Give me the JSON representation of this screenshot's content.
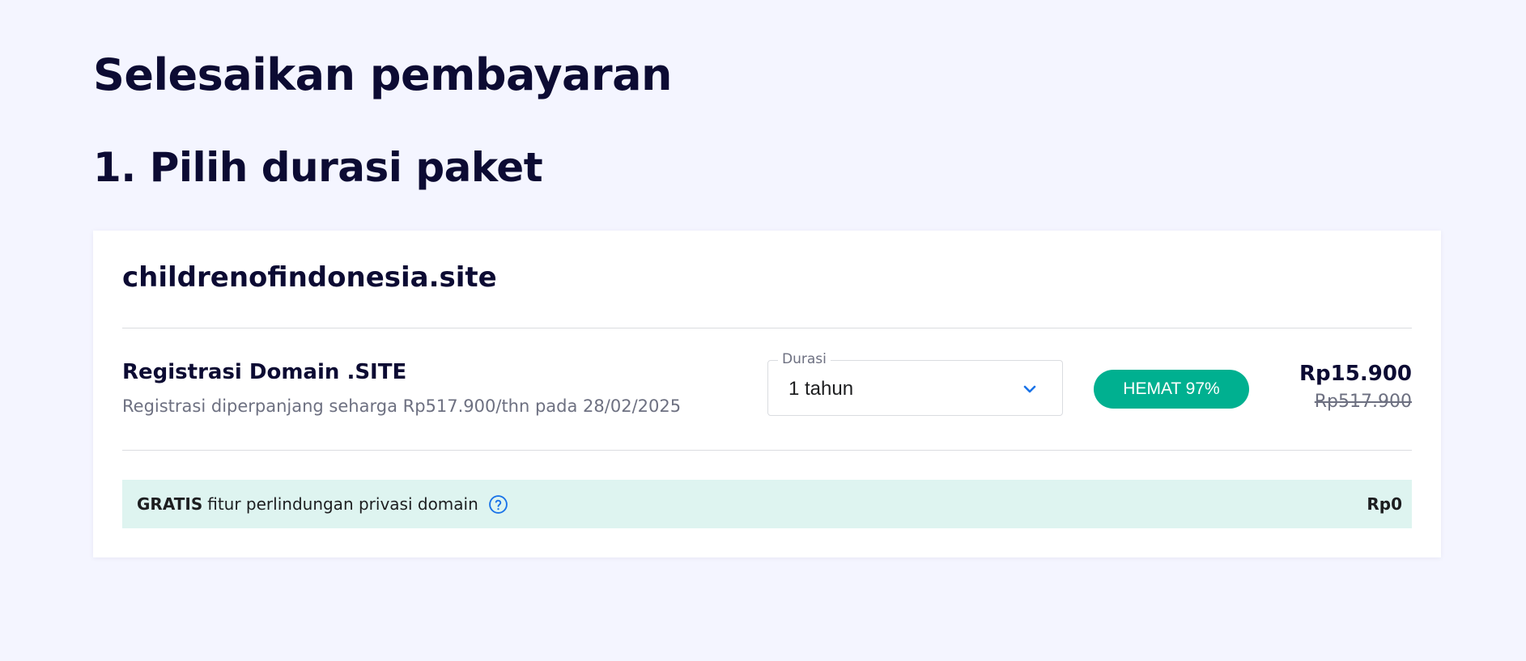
{
  "page": {
    "title": "Selesaikan pembayaran",
    "section_title": "1. Pilih durasi paket"
  },
  "card": {
    "domain_name": "childrenofindonesia.site",
    "product": {
      "name": "Registrasi Domain .SITE",
      "renewal_note": "Registrasi diperpanjang seharga Rp517.900/thn pada 28/02/2025"
    },
    "duration": {
      "legend": "Durasi",
      "selected": "1 tahun",
      "icon": "chevron-down-icon"
    },
    "save_badge": "HEMAT 97%",
    "price": {
      "current": "Rp15.900",
      "original": "Rp517.900"
    },
    "privacy": {
      "strong": "GRATIS",
      "text": "fitur perlindungan privasi domain",
      "icon": "help-circle-icon",
      "price": "Rp0"
    }
  },
  "colors": {
    "background": "#f4f5ff",
    "heading": "#0c0b33",
    "muted": "#6d7081",
    "accent_blue": "#1a73e8",
    "badge_green": "#00b090",
    "privacy_bar": "#def4f0"
  }
}
